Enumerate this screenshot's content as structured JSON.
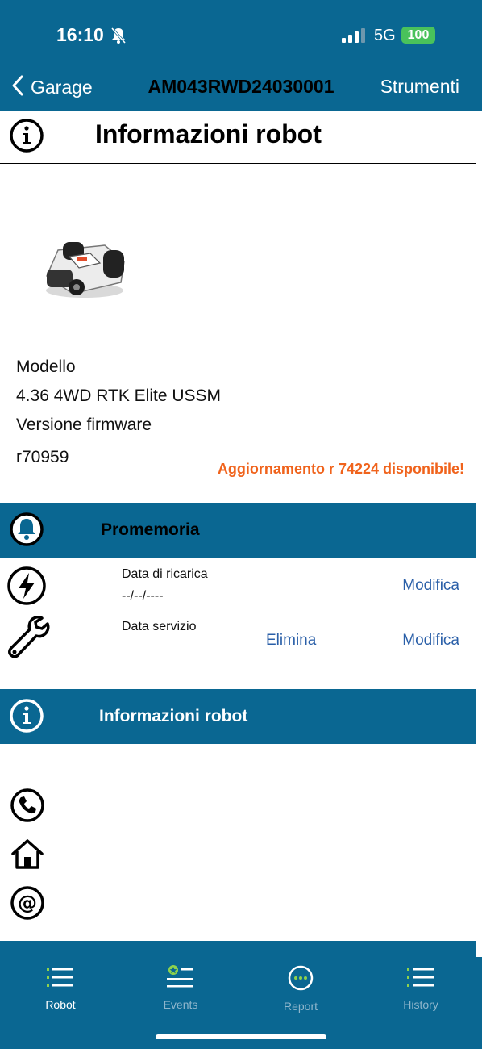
{
  "status_bar": {
    "time": "16:10",
    "network": "5G",
    "battery": "100"
  },
  "nav": {
    "back_label": "Garage",
    "title": "AM043RWD24030001",
    "tools_label": "Strumenti"
  },
  "header": {
    "title": "Informazioni robot"
  },
  "robot": {
    "model_label": "Modello",
    "model_value": "4.36 4WD RTK Elite USSM",
    "firmware_label": "Versione firmware",
    "firmware_value": "r70959",
    "update_notice": "Aggiornamento r 74224 disponibile!"
  },
  "reminders": {
    "section_title": "Promemoria",
    "recharge": {
      "label": "Data di ricarica",
      "value": "--/--/----",
      "edit": "Modifica"
    },
    "service": {
      "label": "Data servizio",
      "delete": "Elimina",
      "edit": "Modifica"
    }
  },
  "contact": {
    "section_title": "Informazioni robot"
  },
  "tabs": [
    {
      "label": "Robot",
      "active": true
    },
    {
      "label": "Events",
      "active": false
    },
    {
      "label": "Report",
      "active": false
    },
    {
      "label": "History",
      "active": false
    }
  ],
  "colors": {
    "primary": "#0a6792",
    "accent_orange": "#f0631c",
    "link_blue": "#2a5fa8",
    "tab_active": "#ffffff",
    "tab_inactive": "#8fb6cc",
    "tab_icon_green": "#8ed24c"
  }
}
